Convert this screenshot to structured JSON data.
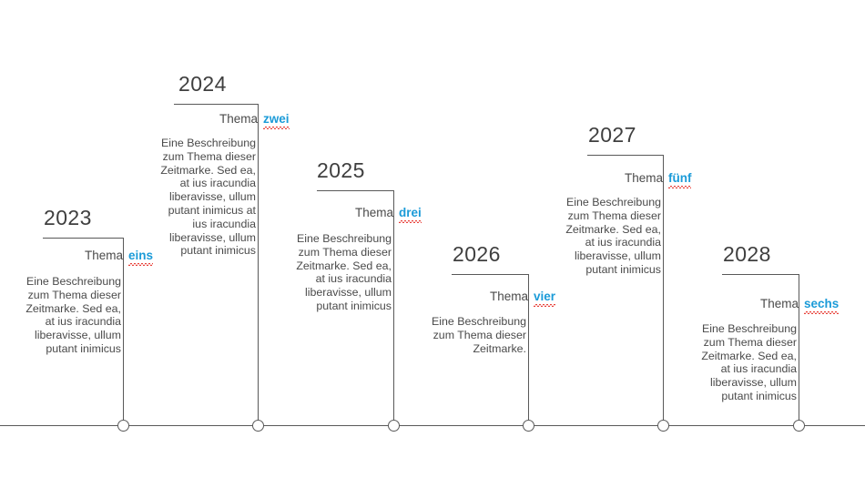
{
  "page": {
    "background_color": "#ffffff",
    "axis_color": "#595959",
    "accent_color": "#1b9bd8",
    "spellcheck_underline_color": "#e8413a",
    "text_color": "#4a4a4a",
    "year_color": "#3f3f3f"
  },
  "timeline": {
    "events": [
      {
        "year": "2023",
        "thema_label": "Thema",
        "number_word": "eins",
        "description": "Eine Beschreibung zum Thema dieser Zeitmarke. Sed ea, at ius iracundia liberavisse, ullum putant inimicus",
        "lines": [
          "Eine Beschreibung",
          "zum Thema dieser",
          "Zeitmarke. Sed ea,",
          "at ius iracundia",
          "liberavisse, ullum",
          "putant inimicus"
        ]
      },
      {
        "year": "2024",
        "thema_label": "Thema",
        "number_word": "zwei",
        "description": "Eine Beschreibung zum Thema dieser Zeitmarke. Sed ea, at ius iracundia liberavisse, ullum putant inimicus at ius iracundia liberavisse, ullum putant inimicus",
        "lines": [
          "Eine Beschreibung",
          "zum Thema dieser",
          "Zeitmarke. Sed ea,",
          "at ius iracundia",
          "liberavisse, ullum",
          "putant inimicus at",
          "ius iracundia",
          "liberavisse, ullum",
          "putant inimicus"
        ]
      },
      {
        "year": "2025",
        "thema_label": "Thema",
        "number_word": "drei",
        "description": "Eine Beschreibung zum Thema dieser Zeitmarke. Sed ea, at ius iracundia liberavisse, ullum putant inimicus",
        "lines": [
          "Eine Beschreibung",
          "zum Thema dieser",
          "Zeitmarke. Sed ea,",
          "at ius iracundia",
          "liberavisse, ullum",
          "putant inimicus"
        ]
      },
      {
        "year": "2026",
        "thema_label": "Thema",
        "number_word": "vier",
        "description": "Eine Beschreibung zum Thema dieser Zeitmarke.",
        "lines": [
          "Eine Beschreibung",
          "zum Thema dieser",
          "Zeitmarke."
        ]
      },
      {
        "year": "2027",
        "thema_label": "Thema",
        "number_word": "fünf",
        "description": "Eine Beschreibung zum Thema dieser Zeitmarke. Sed ea, at ius iracundia liberavisse, ullum putant inimicus",
        "lines": [
          "Eine Beschreibung",
          "zum Thema dieser",
          "Zeitmarke. Sed ea,",
          "at ius iracundia",
          "liberavisse, ullum",
          "putant inimicus"
        ]
      },
      {
        "year": "2028",
        "thema_label": "Thema",
        "number_word": "sechs",
        "description": "Eine Beschreibung zum Thema dieser Zeitmarke. Sed ea, at ius iracundia liberavisse, ullum putant inimicus",
        "lines": [
          "Eine Beschreibung",
          "zum Thema dieser",
          "Zeitmarke. Sed ea,",
          "at ius iracundia",
          "liberavisse, ullum",
          "putant inimicus"
        ]
      }
    ]
  }
}
